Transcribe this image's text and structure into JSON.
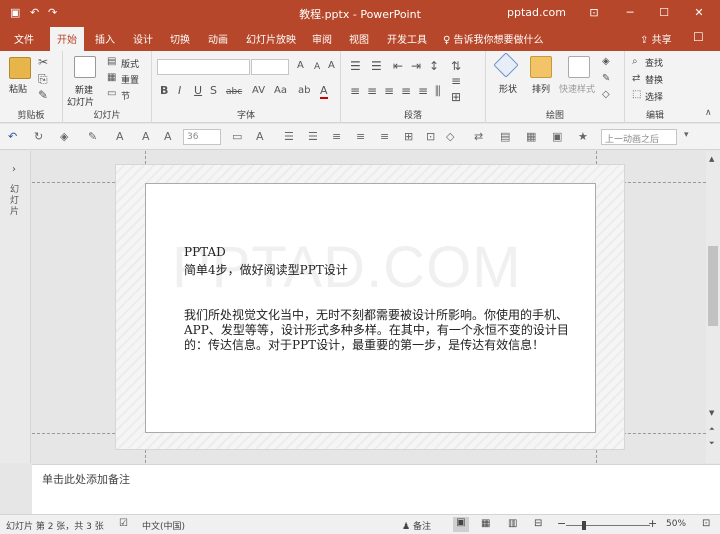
{
  "window": {
    "title": "教程.pptx - PowerPoint",
    "account": "pptad.com"
  },
  "tabs": [
    "文件",
    "开始",
    "插入",
    "设计",
    "切换",
    "动画",
    "幻灯片放映",
    "审阅",
    "视图",
    "开发工具"
  ],
  "active_tab": "开始",
  "tell_me": "告诉我你想要做什么",
  "share_label": "共享",
  "ribbon": {
    "clipboard": {
      "paste": "粘贴",
      "group": "剪贴板"
    },
    "slides": {
      "new_slide_line1": "新建",
      "new_slide_line2": "幻灯片",
      "layout": "版式",
      "reset": "重置",
      "section": "节",
      "group": "幻灯片"
    },
    "font": {
      "group": "字体"
    },
    "paragraph": {
      "group": "段落"
    },
    "drawing": {
      "shapes": "形状",
      "arrange": "排列",
      "quick_styles": "快速样式",
      "group": "绘图"
    },
    "editing": {
      "find": "查找",
      "replace": "替换",
      "select": "选择",
      "group": "编辑"
    }
  },
  "quick_toolbar": {
    "font_size": "36",
    "animation_placeholder": "上一动画之后"
  },
  "left_pane": {
    "label": "幻灯片"
  },
  "slide": {
    "watermark": "PPTAD.COM",
    "title_line1": "PPTAD",
    "title_line2": "简单4步，做好阅读型PPT设计",
    "body": "我们所处视觉文化当中，无时不刻都需要被设计所影响。你使用的手机、APP、发型等等，设计形式多种多样。在其中，有一个永恒不变的设计目的：传达信息。对于PPT设计，最重要的第一步，是传达有效信息！"
  },
  "notes_placeholder": "单击此处添加备注",
  "status": {
    "slide_info": "幻灯片 第 2 张，共 3 张",
    "language": "中文(中国)",
    "notes": "备注",
    "zoom": "50%"
  },
  "colors": {
    "accent": "#b7472a",
    "ribbon_bg": "#f3f3f3"
  }
}
